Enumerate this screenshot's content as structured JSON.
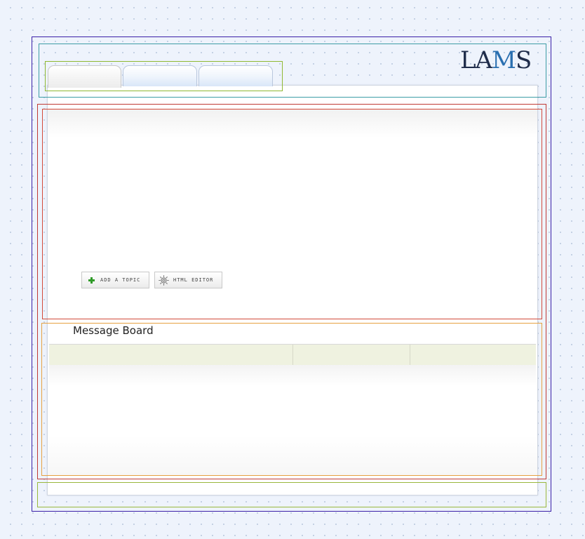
{
  "header": {
    "logo": {
      "icon": "lams-logo",
      "text_a": "LA",
      "text_m": "M",
      "text_s": "S"
    },
    "tabs": [
      {
        "label": "",
        "active": true
      },
      {
        "label": "",
        "active": false
      },
      {
        "label": "",
        "active": false
      }
    ]
  },
  "toolbar": {
    "add_topic_label": "ADD A TOPIC",
    "add_topic_icon": "plus-icon",
    "html_editor_label": "HTML EDITOR",
    "html_editor_icon": "gear-icon"
  },
  "message_board": {
    "title": "Message Board",
    "columns": [
      "",
      "",
      ""
    ],
    "rows": []
  },
  "colors": {
    "background": "#eef3fc",
    "tab_fill": "#d9e7f8",
    "table_header": "#eff2e0",
    "plus_green": "#2f9a28",
    "logo_dark": "#1f2c4a",
    "logo_blue": "#2a6fb0"
  }
}
